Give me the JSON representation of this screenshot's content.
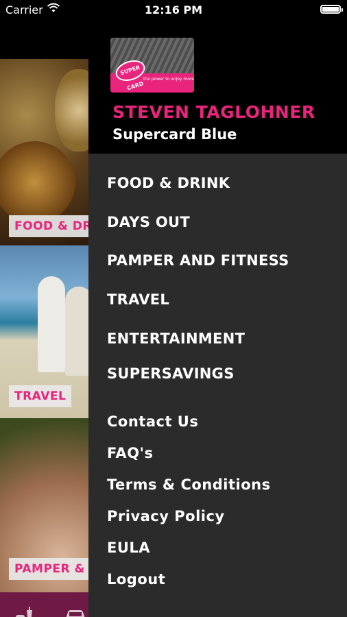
{
  "status_bar": {
    "carrier": "Carrier",
    "time": "12:16 PM"
  },
  "background": {
    "tiles": [
      {
        "label": "FOOD & DR",
        "image": "food-photo"
      },
      {
        "label": "TRAVEL",
        "image": "beach-couple-photo"
      },
      {
        "label": "PAMPER &",
        "image": "spa-photo"
      }
    ],
    "tab_icons": [
      "food-drink-icon",
      "car-icon"
    ]
  },
  "drawer": {
    "logo": {
      "brand": "SUPER CARD",
      "tagline": "the power to enjoy more"
    },
    "user_name": "STEVEN TAGLOHNER",
    "card_type": "Supercard Blue",
    "categories": [
      "FOOD & DRINK",
      "DAYS OUT",
      "PAMPER AND FITNESS",
      "TRAVEL",
      "ENTERTAINMENT",
      "SUPERSAVINGS"
    ],
    "links": [
      "Contact Us",
      "FAQ's",
      "Terms & Conditions",
      "Privacy Policy",
      "EULA",
      "Logout"
    ]
  },
  "colors": {
    "accent": "#e8247c",
    "drawer_bg": "#2b2b2b",
    "header_bg": "#000000",
    "tabbar_bg": "#6e1a44"
  }
}
